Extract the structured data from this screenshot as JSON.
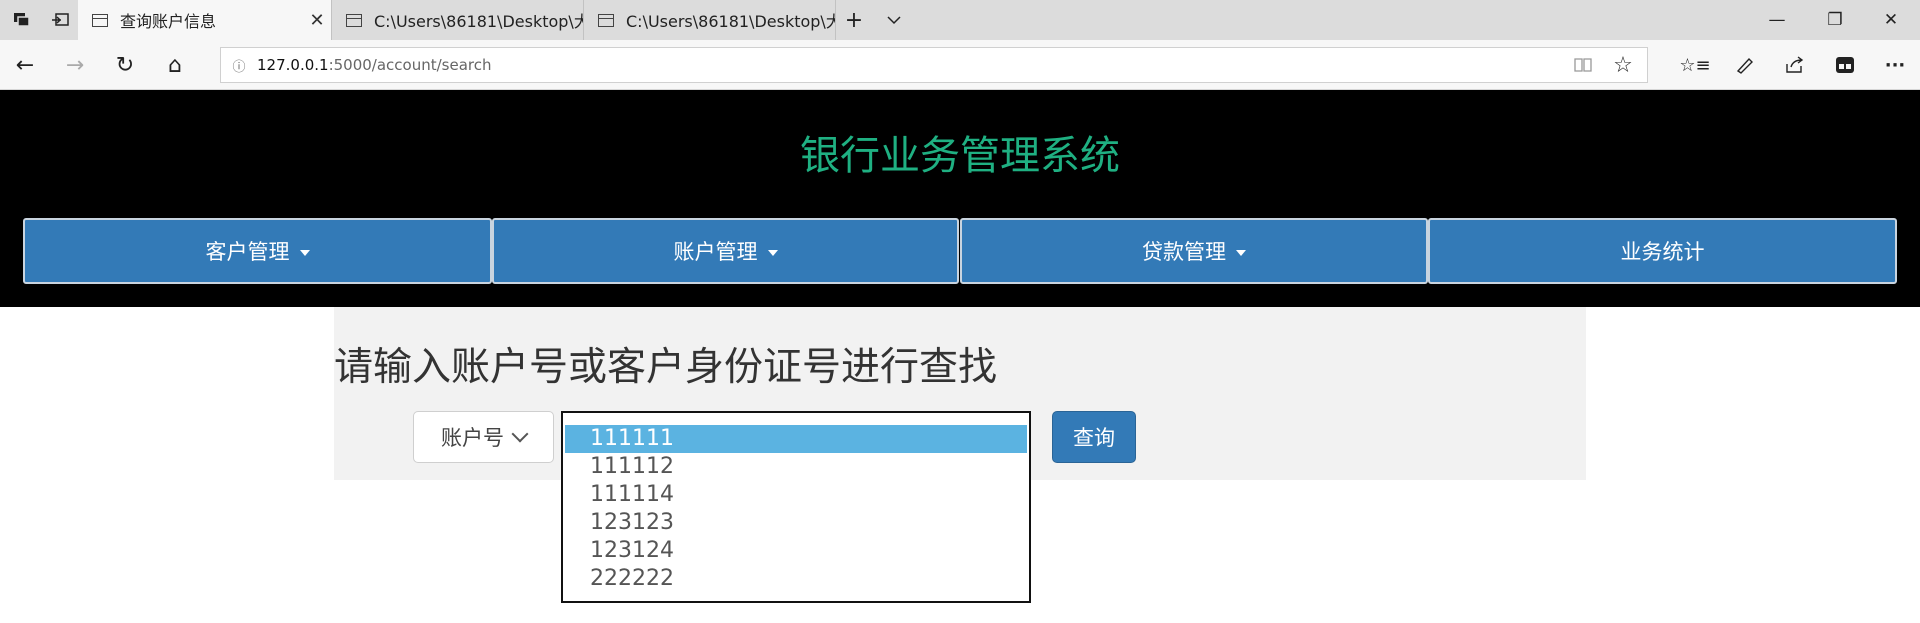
{
  "browser": {
    "tabs": [
      {
        "label": "查询账户信息",
        "active": true
      },
      {
        "label": "C:\\Users\\86181\\Desktop\\大",
        "active": false
      },
      {
        "label": "C:\\Users\\86181\\Desktop\\大",
        "active": false
      }
    ],
    "address": {
      "host": "127.0.0.1",
      "path": ":5000/account/search"
    },
    "icons": {
      "tab_switcher": "tab-switcher-icon",
      "set_aside": "set-aside-tabs-icon",
      "new_tab": "+",
      "tab_list": "chevron-down-icon",
      "back": "←",
      "forward": "→",
      "refresh": "↻",
      "home": "⌂",
      "reading_view": "book-icon",
      "favorite": "☆",
      "favorites_hub": "☆≡",
      "pen": "pen-icon",
      "share": "share-icon",
      "extension": "extension-icon",
      "more": "···",
      "minimize": "—",
      "restore": "❐",
      "close": "✕"
    }
  },
  "site": {
    "title": "银行业务管理系统",
    "title_color": "#1fb082",
    "menu": [
      {
        "label": "客户管理",
        "dropdown": true
      },
      {
        "label": "账户管理",
        "dropdown": true
      },
      {
        "label": "贷款管理",
        "dropdown": true
      },
      {
        "label": "业务统计",
        "dropdown": false
      }
    ]
  },
  "search": {
    "heading": "请输入账户号或客户身份证号进行查找",
    "type_select": {
      "selected": "账户号"
    },
    "id_options": [
      "111111",
      "111112",
      "111114",
      "123123",
      "123124",
      "222222"
    ],
    "selected_option": "111111",
    "query_button": "查询"
  },
  "colors": {
    "accent": "#337ab7",
    "header_bg": "#000000",
    "option_highlight": "#5bb3e1"
  }
}
